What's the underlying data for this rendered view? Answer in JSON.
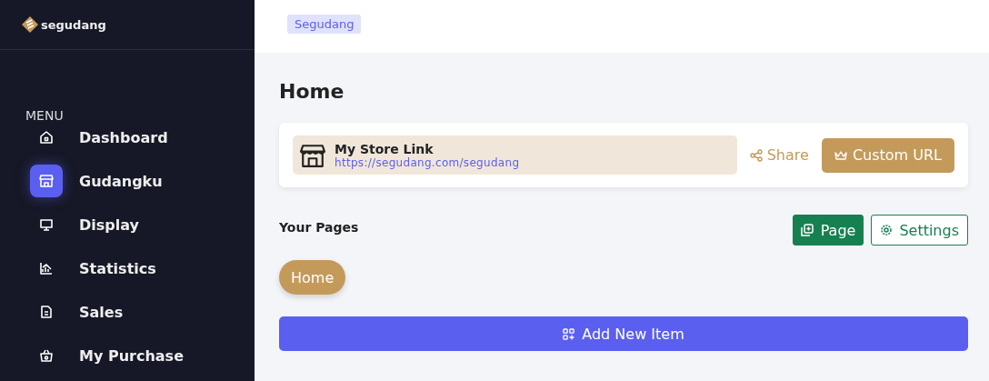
{
  "brand": "segudang",
  "menu_heading": "MENU",
  "sidebar": {
    "items": [
      {
        "label": "Dashboard",
        "selected": false
      },
      {
        "label": "Gudangku",
        "selected": true
      },
      {
        "label": "Display",
        "selected": false
      },
      {
        "label": "Statistics",
        "selected": false
      },
      {
        "label": "Sales",
        "selected": false
      },
      {
        "label": "My Purchase",
        "selected": false
      }
    ]
  },
  "header": {
    "store_badge": "Segudang"
  },
  "page_title": "Home",
  "store_link": {
    "title": "My Store Link",
    "url": "https://segudang.com/segudang",
    "share": "Share",
    "custom_url": "Custom URL"
  },
  "pages_section": {
    "title": "Your Pages",
    "page_button": "Page",
    "settings_button": "Settings",
    "pages": [
      {
        "label": "Home",
        "selected": true
      }
    ]
  },
  "add_button": "Add New Item"
}
